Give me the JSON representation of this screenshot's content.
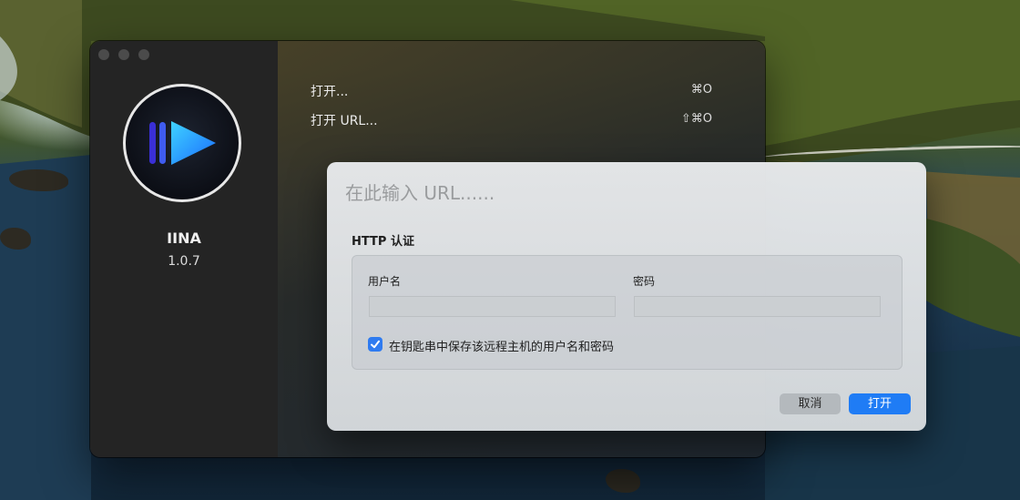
{
  "app": {
    "name": "IINA",
    "version": "1.0.7",
    "logo_icon": "iina-play-logo-icon"
  },
  "menu": {
    "items": [
      {
        "label": "打开...",
        "shortcut": "⌘O"
      },
      {
        "label": "打开 URL...",
        "shortcut": "⇧⌘O"
      }
    ]
  },
  "url_dialog": {
    "url_placeholder": "在此输入 URL......",
    "auth_title": "HTTP 认证",
    "username_label": "用户名",
    "password_label": "密码",
    "username_value": "",
    "password_value": "",
    "keychain_label": "在钥匙串中保存该远程主机的用户名和密码",
    "keychain_checked": true,
    "cancel_label": "取消",
    "open_label": "打开"
  },
  "colors": {
    "accent": "#1f7cf5",
    "sidebar_bg": "#242424",
    "dialog_bg": "#e6e8ea"
  }
}
